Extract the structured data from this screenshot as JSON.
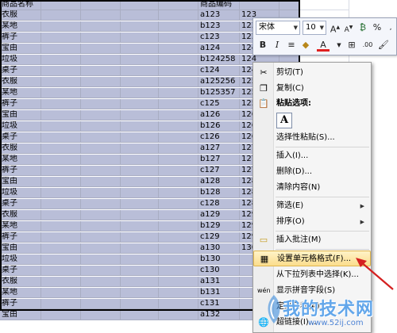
{
  "sheet": {
    "headers": [
      "商品名称",
      "",
      "",
      "",
      "",
      "商品编码",
      "",
      "",
      ""
    ],
    "rows": [
      [
        "衣服",
        "a123",
        "123"
      ],
      [
        "某地",
        "b123",
        "123"
      ],
      [
        "裤子",
        "c123",
        "123"
      ],
      [
        "宝由",
        "a124",
        "124"
      ],
      [
        "垃圾",
        "b124258",
        "124"
      ],
      [
        "桌子",
        "c124",
        "124"
      ],
      [
        "衣服",
        "a125256",
        "125"
      ],
      [
        "某地",
        "b125357",
        "125"
      ],
      [
        "裤子",
        "c125",
        "125"
      ],
      [
        "宝由",
        "a126",
        "126"
      ],
      [
        "垃圾",
        "b126",
        "126"
      ],
      [
        "桌子",
        "c126",
        "126"
      ],
      [
        "衣服",
        "a127",
        "127"
      ],
      [
        "某地",
        "b127",
        "127"
      ],
      [
        "裤子",
        "c127",
        "127"
      ],
      [
        "宝由",
        "a128",
        "128"
      ],
      [
        "垃圾",
        "b128",
        "128"
      ],
      [
        "桌子",
        "c128",
        "128"
      ],
      [
        "衣服",
        "a129",
        "129"
      ],
      [
        "某地",
        "b129",
        "129"
      ],
      [
        "裤子",
        "c129",
        "129"
      ],
      [
        "宝由",
        "a130",
        "130"
      ],
      [
        "垃圾",
        "b130",
        ""
      ],
      [
        "桌子",
        "c130",
        ""
      ],
      [
        "衣服",
        "a131",
        ""
      ],
      [
        "某地",
        "b131",
        ""
      ],
      [
        "裤子",
        "c131",
        ""
      ],
      [
        "宝由",
        "a132",
        ""
      ]
    ]
  },
  "mini_toolbar": {
    "font_name": "宋体",
    "font_size": "10",
    "bold": "B",
    "italic": "I",
    "font_color_letter": "A"
  },
  "context_menu": {
    "cut": "剪切(T)",
    "copy": "复制(C)",
    "paste_options": "粘贴选项:",
    "paste_option_a": "A",
    "paste_special": "选择性粘贴(S)...",
    "insert": "插入(I)...",
    "delete": "删除(D)...",
    "clear_contents": "清除内容(N)",
    "filter": "筛选(E)",
    "sort": "排序(O)",
    "insert_comment": "插入批注(M)",
    "format_cells": "设置单元格格式(F)...",
    "pick_from_list": "从下拉列表中选择(K)...",
    "phonetic": "显示拼音字段(S)",
    "define_name": "定义名称(A)...",
    "hyperlink": "超链接(I)..."
  },
  "watermark": {
    "text": "我的技术网",
    "url": "www.52ij.com"
  },
  "colors": {
    "selection": "#b9bed8",
    "highlight_border": "#e0b54e",
    "arrow": "#d42020"
  }
}
